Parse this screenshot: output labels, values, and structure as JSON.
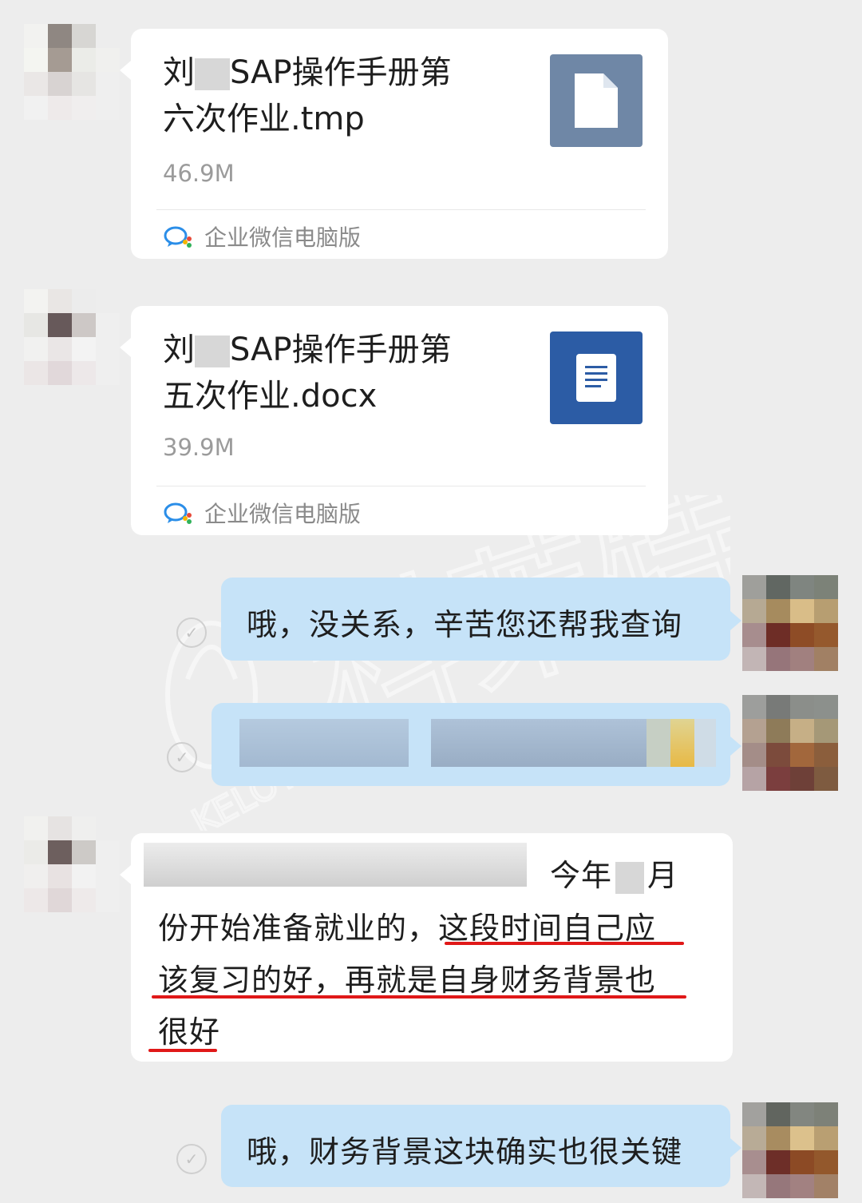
{
  "messages": [
    {
      "type": "file",
      "file_name_line1": "刘",
      "file_name_line1b": "SAP操作手册第",
      "file_name_line2": "六次作业.tmp",
      "size": "46.9M",
      "source": "企业微信电脑版",
      "icon": "generic-file-icon",
      "icon_color": "#6f87a6"
    },
    {
      "type": "file",
      "file_name_line1": "刘",
      "file_name_line1b": "SAP操作手册第",
      "file_name_line2": "五次作业.docx",
      "size": "39.9M",
      "source": "企业微信电脑版",
      "icon": "word-doc-icon",
      "icon_color": "#2c5ca5"
    },
    {
      "type": "text_out",
      "text": "哦，没关系，辛苦您还帮我查询"
    },
    {
      "type": "text_in",
      "line1_tail_a": "今年",
      "line1_tail_b": "月",
      "line2a": "份开始准备就业的，",
      "line2b": "这段时间自己应",
      "line3": "该复习的好，再就是自身财务背景也",
      "line4": "很好"
    },
    {
      "type": "text_out",
      "text": "哦，财务背景这块确实也很关键"
    }
  ],
  "watermark": {
    "brand": "科莱特",
    "brand_latin": "KELOTE"
  },
  "colors": {
    "outgoing_bubble": "#c6e3f8",
    "incoming_bubble": "#ffffff",
    "background": "#ededed",
    "underline": "#e01818"
  }
}
